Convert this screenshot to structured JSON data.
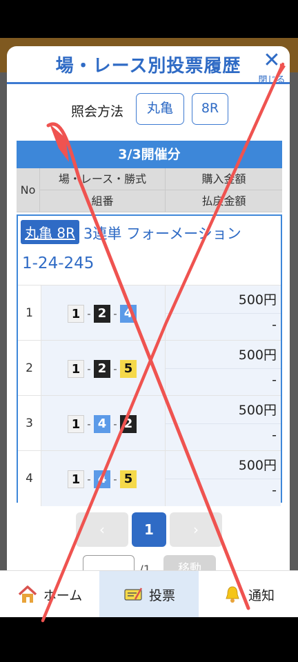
{
  "modal": {
    "title": "場・レース別投票履歴",
    "close_label": "閉じる"
  },
  "inquiry": {
    "label": "照会方法",
    "venue": "丸亀",
    "race": "8R"
  },
  "table": {
    "session": "3/3開催分",
    "headers": {
      "no": "No",
      "venue_race_type": "場・レース・勝式",
      "purchase": "購入金額",
      "combination": "組番",
      "payout": "払戻金額"
    }
  },
  "entry": {
    "venue_race": "丸亀 8R",
    "bet_type": "3連単 フォーメーション",
    "combo": "1-24-245",
    "rows": [
      {
        "no": "1",
        "picks": [
          "1",
          "2",
          "4"
        ],
        "amount": "500円",
        "payout": "-"
      },
      {
        "no": "2",
        "picks": [
          "1",
          "2",
          "5"
        ],
        "amount": "500円",
        "payout": "-"
      },
      {
        "no": "3",
        "picks": [
          "1",
          "4",
          "2"
        ],
        "amount": "500円",
        "payout": "-"
      },
      {
        "no": "4",
        "picks": [
          "1",
          "4",
          "5"
        ],
        "amount": "500円",
        "payout": "-"
      }
    ]
  },
  "pager": {
    "prev": "‹",
    "current": "1",
    "next": "›",
    "total": "/1",
    "go_label": "移動"
  },
  "nav": {
    "home": "ホーム",
    "vote": "投票",
    "notice": "通知"
  },
  "colors": {
    "accent": "#2f6bc5",
    "header_orange": "#e8a33a",
    "boat_1": "#f2f2f2",
    "boat_2": "#222222",
    "boat_4": "#5b9ae8",
    "boat_5": "#f5d94a",
    "cross_mark": "#ef5350"
  },
  "icons": [
    "home-icon",
    "ticket-icon",
    "bell-icon",
    "close-icon",
    "chevron-left-icon",
    "chevron-right-icon"
  ]
}
